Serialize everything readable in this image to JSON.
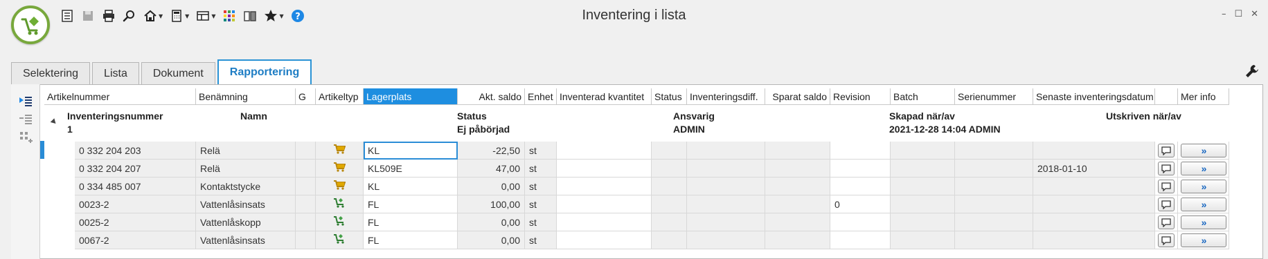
{
  "window": {
    "title": "Inventering i lista",
    "minimize": "–",
    "maximize": "☐",
    "close": "✕"
  },
  "toolbar": {
    "icons": [
      "list-icon",
      "save-icon",
      "print-icon",
      "search-icon",
      "home-icon",
      "calculator-icon",
      "layout-icon",
      "grid-colors-icon",
      "books-icon",
      "star-icon",
      "help-icon"
    ]
  },
  "tabs": [
    {
      "label": "Selektering",
      "active": false
    },
    {
      "label": "Lista",
      "active": false
    },
    {
      "label": "Dokument",
      "active": false
    },
    {
      "label": "Rapportering",
      "active": true
    }
  ],
  "columns": [
    {
      "label": "Artikelnummer"
    },
    {
      "label": "Benämning"
    },
    {
      "label": "G"
    },
    {
      "label": "Artikeltyp"
    },
    {
      "label": "Lagerplats",
      "active": true
    },
    {
      "label": "Akt. saldo"
    },
    {
      "label": "Enhet"
    },
    {
      "label": "Inventerad kvantitet"
    },
    {
      "label": "Status"
    },
    {
      "label": "Inventeringsdiff."
    },
    {
      "label": "Sparat saldo"
    },
    {
      "label": "Revision"
    },
    {
      "label": "Batch"
    },
    {
      "label": "Serienummer"
    },
    {
      "label": "Senaste inventeringsdatum"
    },
    {
      "label": ""
    },
    {
      "label": "Mer info"
    }
  ],
  "group": {
    "number_label": "Inventeringsnummer",
    "number_value": "1",
    "name_label": "Namn",
    "status_label": "Status",
    "status_value": "Ej påbörjad",
    "responsible_label": "Ansvarig",
    "responsible_value": "ADMIN",
    "created_label": "Skapad när/av",
    "created_value": "2021-12-28 14:04 ADMIN",
    "printed_label": "Utskriven när/av"
  },
  "rows": [
    {
      "artnr": "0 332 204 203",
      "name": "Relä",
      "type_icon": "cart-icon",
      "location": "KL",
      "saldo": "-22,50",
      "unit": "st",
      "revision": "",
      "last_date": ""
    },
    {
      "artnr": "0 332 204 207",
      "name": "Relä",
      "type_icon": "cart-icon",
      "location": "KL509E",
      "saldo": "47,00",
      "unit": "st",
      "revision": "",
      "last_date": "2018-01-10"
    },
    {
      "artnr": "0 334 485 007",
      "name": "Kontaktstycke",
      "type_icon": "cart-icon",
      "location": "KL",
      "saldo": "0,00",
      "unit": "st",
      "revision": "",
      "last_date": ""
    },
    {
      "artnr": "0023-2",
      "name": "Vattenlåsinsats",
      "type_icon": "manufactured-icon",
      "location": "FL",
      "saldo": "100,00",
      "unit": "st",
      "revision": "0",
      "last_date": ""
    },
    {
      "artnr": "0025-2",
      "name": "Vattenlåskopp",
      "type_icon": "manufactured-icon",
      "location": "FL",
      "saldo": "0,00",
      "unit": "st",
      "revision": "",
      "last_date": ""
    },
    {
      "artnr": "0067-2",
      "name": "Vattenlåsinsats",
      "type_icon": "manufactured-icon",
      "location": "FL",
      "saldo": "0,00",
      "unit": "st",
      "revision": "",
      "last_date": ""
    }
  ],
  "more_info_label": "»",
  "colors": {
    "accent": "#1e8ee0",
    "logo_green": "#78a83c"
  }
}
